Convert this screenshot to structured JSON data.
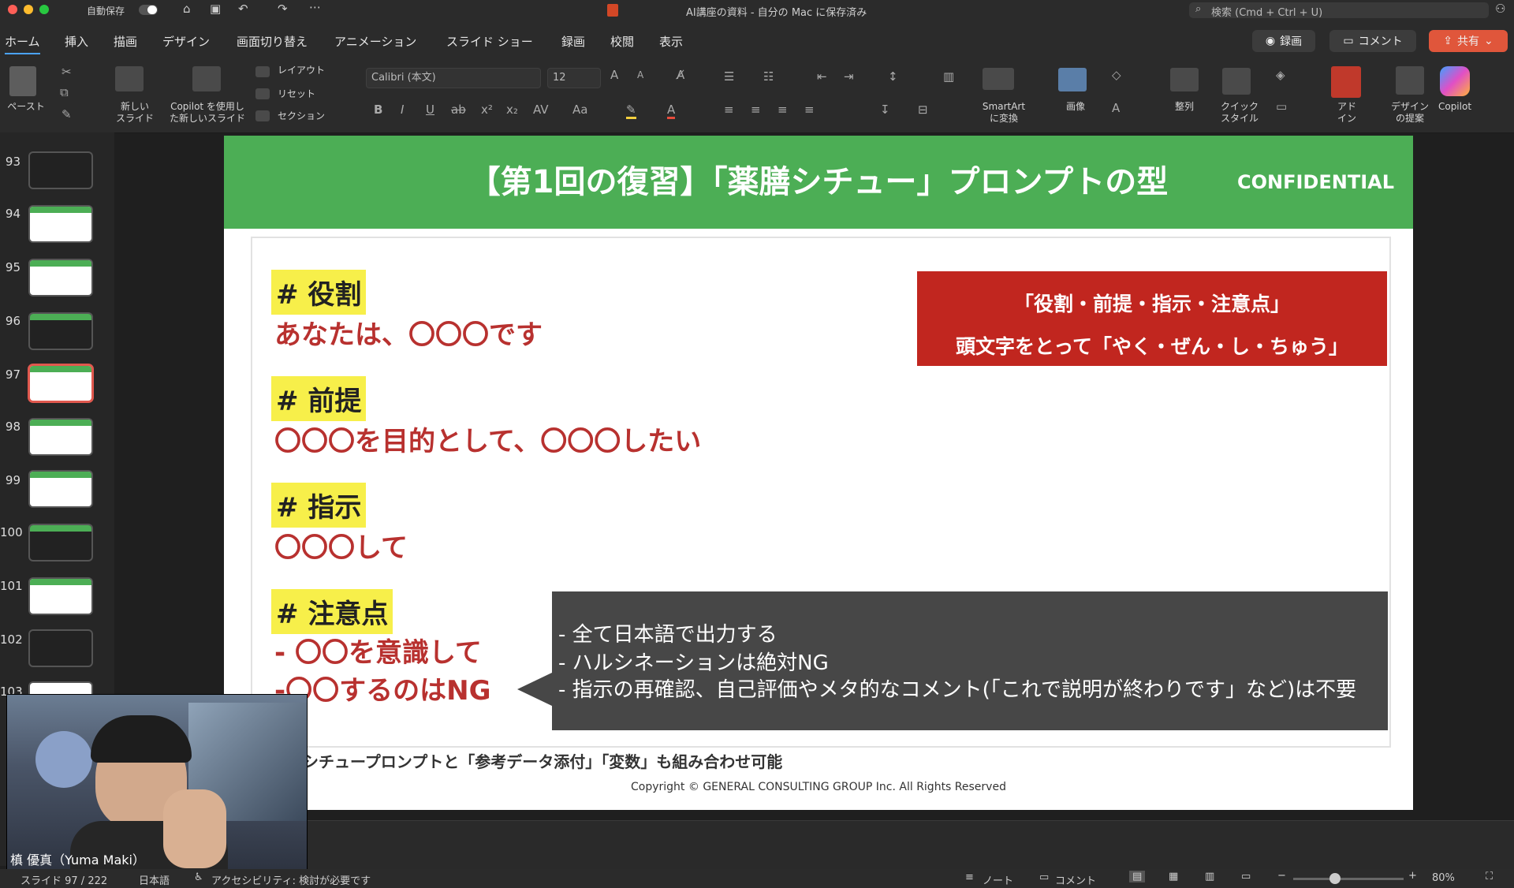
{
  "titlebar": {
    "autosave_label": "自動保存",
    "doc_title": "AI講座の資料 - 自分の Mac に保存済み",
    "search_placeholder": "検索 (Cmd + Ctrl + U)"
  },
  "menu": {
    "tabs": [
      "ホーム",
      "挿入",
      "描画",
      "デザイン",
      "画面切り替え",
      "アニメーション",
      "スライド ショー",
      "録画",
      "校閲",
      "表示"
    ],
    "record_label": "録画",
    "comment_label": "コメント",
    "share_label": "共有"
  },
  "ribbon": {
    "paste_label": "ペースト",
    "new_slide_label": "新しい\nスライド",
    "copilot_slide_label": "Copilot を使用し\nた新しいスライド",
    "layout_label": "レイアウト",
    "reset_label": "リセット",
    "section_label": "セクション",
    "font_name": "Calibri (本文)",
    "font_size": "12",
    "smartart_label": "SmartArt\nに変換",
    "image_label": "画像",
    "arrange_label": "整列",
    "quick_style_label": "クイック\nスタイル",
    "addin_label": "アド\nイン",
    "design_label": "デザイン\nの提案",
    "copilot_label": "Copilot"
  },
  "thumbnails": [
    "93",
    "94",
    "95",
    "96",
    "97",
    "98",
    "99",
    "100",
    "101",
    "102",
    "103"
  ],
  "selected_slide": "97",
  "slide": {
    "title": "【第1回の復習】「薬膳シチュー」プロンプトの型",
    "confidential": "CONFIDENTIAL",
    "sections": [
      {
        "heading": "# 役割",
        "lines": [
          "あなたは、〇〇〇です"
        ]
      },
      {
        "heading": "# 前提",
        "lines": [
          "〇〇〇を目的として、〇〇〇したい"
        ]
      },
      {
        "heading": "# 指示",
        "lines": [
          "〇〇〇して"
        ]
      },
      {
        "heading": "# 注意点",
        "lines": [
          "- 〇〇を意識して",
          "-〇〇するのはNG"
        ]
      }
    ],
    "redbox": {
      "line1": "「役割・前提・指示・注意点」",
      "line2": "頭文字をとって「やく・ぜん・し・ちゅう」"
    },
    "darkbox": [
      "- 全て日本語で出力する",
      "- ハルシネーションは絶対NG",
      "- 指示の再確認、自己評価やメタ的なコメント(「これで説明が終わりです」など)は不要"
    ],
    "footnote": "シチュープロンプトと「参考データ添付」「変数」も組み合わせ可能",
    "copyright": "Copyright © GENERAL CONSULTING GROUP Inc. All Rights Reserved"
  },
  "webcam": {
    "name": "槙 優真（Yuma Maki）"
  },
  "status": {
    "slide_counter": "スライド 97 / 222",
    "language": "日本語",
    "accessibility": "アクセシビリティ: 検討が必要です",
    "notes_label": "ノート",
    "comments_label": "コメント",
    "zoom": "80%"
  },
  "colors": {
    "slide_header": "#4cae55",
    "red_box": "#c1261f",
    "highlight": "#f7ef4a",
    "dark_box": "#474747"
  }
}
